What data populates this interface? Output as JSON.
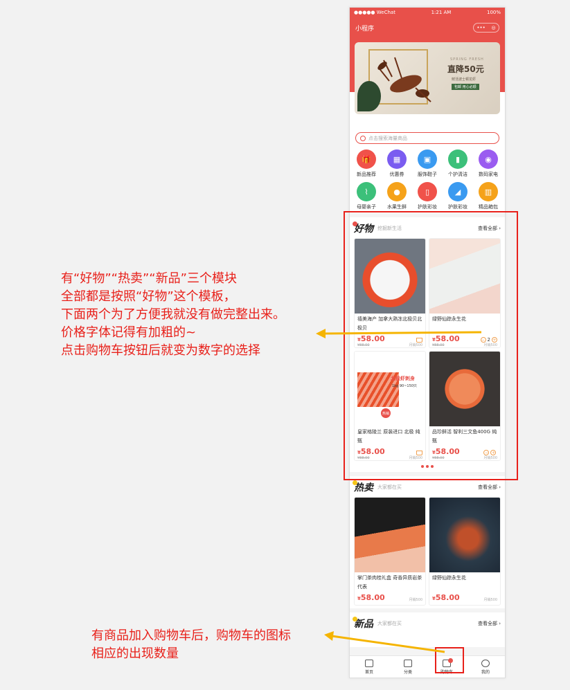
{
  "status_bar": {
    "carrier": "●●●●● WeChat",
    "time": "1:21 AM",
    "battery": "100%"
  },
  "navbar": {
    "title": "小程序",
    "capsule_left": "•••",
    "capsule_right": "◎"
  },
  "banner": {
    "top_text": "SPRING FRESH",
    "headline": "直降50元",
    "line": "鲜活波士顿龙虾",
    "button": "包邮 用心必顺"
  },
  "search": {
    "placeholder": "点击搜索海量商品"
  },
  "categories": [
    {
      "label": "新品推荐",
      "icon": "gift-icon",
      "color": "#f0524a"
    },
    {
      "label": "优惠券",
      "icon": "coupon-icon",
      "color": "#7a5cf0"
    },
    {
      "label": "服饰鞋子",
      "icon": "shirt-icon",
      "color": "#3a9af0"
    },
    {
      "label": "个护清洁",
      "icon": "bottle-icon",
      "color": "#3cc07a"
    },
    {
      "label": "数码家电",
      "icon": "washer-icon",
      "color": "#9a5cf0"
    },
    {
      "label": "母婴亲子",
      "icon": "bottle-baby-icon",
      "color": "#3cc07a"
    },
    {
      "label": "水果生鲜",
      "icon": "orange-icon",
      "color": "#f5a21a"
    },
    {
      "label": "护肤彩妆",
      "icon": "lipstick-icon",
      "color": "#f0524a"
    },
    {
      "label": "护肤彩妆",
      "icon": "shoe-icon",
      "color": "#3a9af0"
    },
    {
      "label": "精品箱包",
      "icon": "bag-icon",
      "color": "#f5a21a"
    }
  ],
  "module_haowu": {
    "logo": "好物",
    "subtitle": "挖掘新生活",
    "more": "查看全部",
    "products": [
      {
        "name": "禧美海产 加拿大熟冻北极贝北极贝",
        "price": "58.00",
        "old": "¥88.00",
        "sold": "月销500",
        "control": "cart"
      },
      {
        "name": "绿野仙踪永生花",
        "price": "58.00",
        "old": "¥88.00",
        "sold": "月销500",
        "control": "stepper",
        "qty": "2"
      },
      {
        "name": "皇家格陵兰 原装进口 北极 纯甄",
        "price": "58.00",
        "old": "¥88.00",
        "sold": "月销500",
        "control": "cart"
      },
      {
        "name": "品珍鲜活 智利三文鱼400G 纯甄",
        "price": "58.00",
        "old": "¥88.00",
        "sold": "月销500",
        "control": "stepper",
        "qty": "0"
      }
    ],
    "promo_tag": "北极虾刺身",
    "promo_sub": "1kg 90~150只",
    "promo_hot": "热销"
  },
  "module_remai": {
    "logo": "热卖",
    "subtitle": "大家都在买",
    "more": "查看全部",
    "products": [
      {
        "name": "掌门茶肉桂礼盒 奇香异质岩茶代表",
        "price": "58.00",
        "sold": "月销500"
      },
      {
        "name": "绿野仙踪永生花",
        "price": "58.00",
        "sold": "月销500"
      }
    ]
  },
  "module_xinpin": {
    "logo": "新品",
    "subtitle": "大家都在买",
    "more": "查看全部"
  },
  "tabbar": [
    {
      "label": "首页",
      "icon": "home-icon"
    },
    {
      "label": "分类",
      "icon": "category-icon"
    },
    {
      "label": "购物车",
      "icon": "cart-icon"
    },
    {
      "label": "我的",
      "icon": "user-icon"
    }
  ],
  "annotations": {
    "note1": [
      "有“好物”“热卖”“新品”三个模块",
      "全部都是按照“好物”这个模板，",
      "下面两个为了方便我就没有做完整出来。",
      "价格字体记得有加粗的~",
      "点击购物车按钮后就变为数字的选择"
    ],
    "note2": [
      "有商品加入购物车后，购物车的图标",
      "相应的出现数量"
    ]
  },
  "colors": {
    "brand": "#e8504a",
    "annotation": "#e8201a",
    "arrow": "#f5b400"
  }
}
